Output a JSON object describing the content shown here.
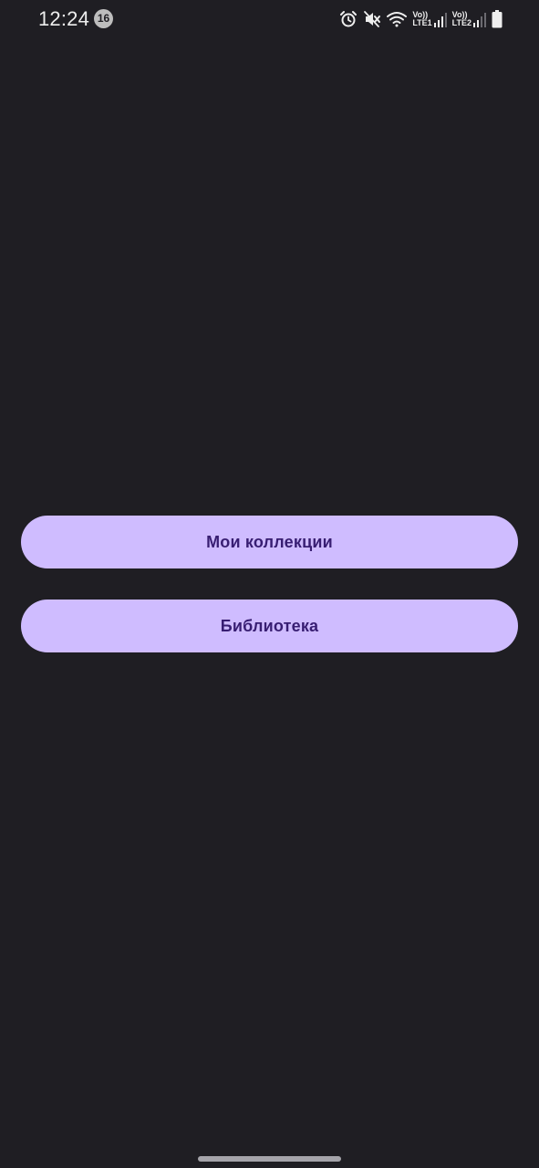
{
  "status_bar": {
    "time": "12:24",
    "notification_count": "16",
    "icons": [
      "alarm-icon",
      "mute-icon",
      "wifi-icon",
      "signal-sim1-icon",
      "signal-sim2-icon",
      "battery-icon"
    ],
    "sim1": {
      "top": "Vo))",
      "bottom": "LTE1"
    },
    "sim2": {
      "top": "Vo))",
      "bottom": "LTE2"
    }
  },
  "main": {
    "buttons": [
      {
        "label": "Мои коллекции"
      },
      {
        "label": "Библиотека"
      }
    ]
  },
  "colors": {
    "background": "#1f1e23",
    "button_background": "#cfbcff",
    "button_text": "#381e72"
  }
}
